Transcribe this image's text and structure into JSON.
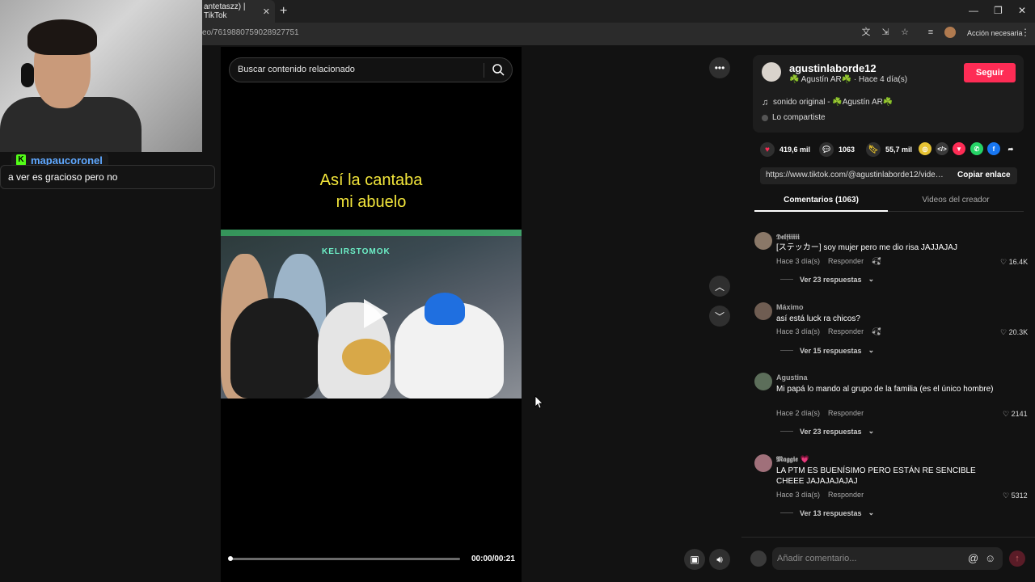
{
  "browser": {
    "tab_title": "antetaszz) | TikTok",
    "url": "eo/7619880759028927751",
    "profile_action": "Acción necesaria"
  },
  "stream": {
    "chat_username": "mapaucoronel",
    "chat_message": "a ver es gracioso pero no"
  },
  "video": {
    "search_placeholder": "Buscar contenido relacionado",
    "caption_line1": "Así la cantaba",
    "caption_line2": "mi abuelo",
    "neon_sign": "KELIRSTOMOK",
    "time": "00:00/00:21",
    "progress": 0
  },
  "author": {
    "name": "agustinlaborde12",
    "subtitle": "☘️ Agustín AR☘️ · Hace 4 día(s)",
    "follow_label": "Seguir",
    "music": "sonido original - ☘️Agustín AR☘️",
    "shared": "Lo compartiste"
  },
  "stats": {
    "likes": "419,6 mil",
    "comments": "1063",
    "saves": "55,7 mil"
  },
  "share_link": {
    "url": "https://www.tiktok.com/@agustinlaborde12/video/...",
    "copy_label": "Copiar enlace"
  },
  "tabs": {
    "comments": "Comentarios (1063)",
    "videos": "Videos del creador"
  },
  "comments": [
    {
      "user": "𝕯𝖊𝖑𝖋𝖎𝖎𝖎𝖎𝖎",
      "text": "[ステッカー] soy mujer pero me dio risa JAJJAJAJ",
      "date": "Hace 3 día(s)",
      "reply": "Responder",
      "likes": "16.4K",
      "replies": "Ver 23 respuestas"
    },
    {
      "user": "Máximo",
      "text": "así está luck ra chicos?",
      "date": "Hace 3 día(s)",
      "reply": "Responder",
      "likes": "20.3K",
      "replies": "Ver 15 respuestas"
    },
    {
      "user": "Agustina",
      "text": "Mi papá lo mando al grupo de la familia (es el único hombre)",
      "date": "Hace 2 día(s)",
      "reply": "Responder",
      "likes": "2141",
      "replies": "Ver 23 respuestas"
    },
    {
      "user": "𝕸𝖆𝖌𝖌𝖎𝖊 💗",
      "text": "LA PTM ES BUENÍSIMO PERO ESTÁN RE SENCIBLE CHEEE JAJAJAJAJAJ",
      "date": "Hace 3 día(s)",
      "reply": "Responder",
      "likes": "5312",
      "replies": "Ver 13 respuestas"
    }
  ],
  "composer": {
    "placeholder": "Añadir comentario..."
  },
  "colors": {
    "accent": "#fe2c55",
    "caption": "#f3e63b",
    "chat_user": "#5fa8ff"
  }
}
